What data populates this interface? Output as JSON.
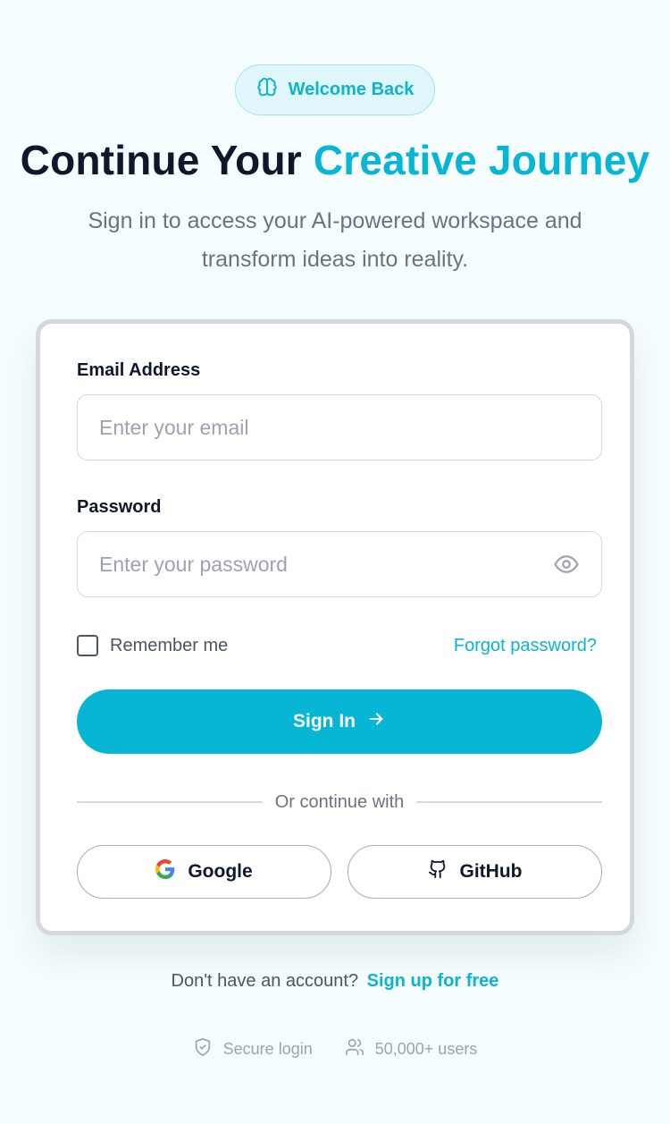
{
  "badge": {
    "icon": "brain-icon",
    "label": "Welcome Back"
  },
  "headline": {
    "part1": "Continue Your ",
    "accent": "Creative Journey"
  },
  "subtitle": "Sign in to access your AI-powered workspace and transform ideas into reality.",
  "form": {
    "email_label": "Email Address",
    "email_placeholder": "Enter your email",
    "email_value": "",
    "password_label": "Password",
    "password_placeholder": "Enter your password",
    "password_value": "",
    "remember_label": "Remember me",
    "remember_checked": false,
    "forgot_label": "Forgot password?",
    "signin_label": "Sign In",
    "divider_label": "Or continue with",
    "google_label": "Google",
    "github_label": "GitHub"
  },
  "signup": {
    "prompt": "Don't have an account?",
    "link": "Sign up for free"
  },
  "footer": {
    "secure_label": "Secure login",
    "users_label": "50,000+ users"
  },
  "colors": {
    "accent": "#07b5d4",
    "background": "#f5fdfe",
    "heading": "#0f172a",
    "muted": "#6b7280"
  }
}
